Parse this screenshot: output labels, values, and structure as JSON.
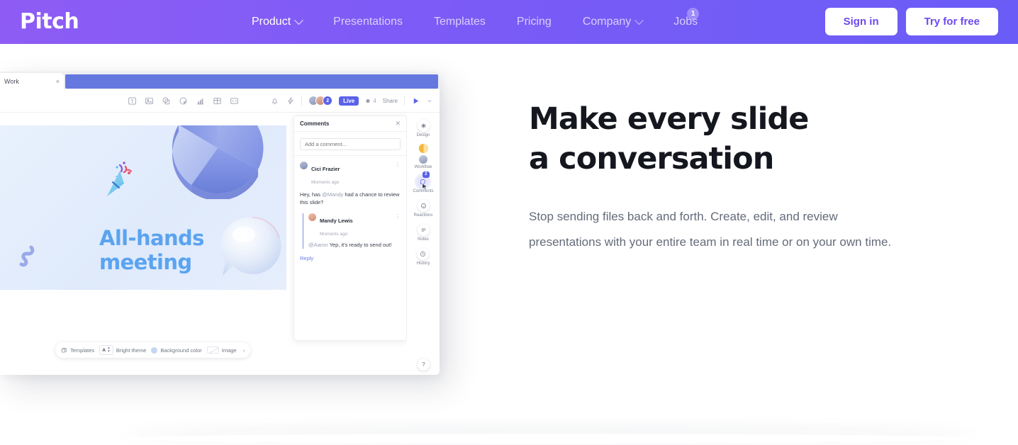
{
  "nav": {
    "brand": "Pitch",
    "links": [
      {
        "label": "Product",
        "has_caret": true,
        "active": true,
        "icon": "chevron-down-icon"
      },
      {
        "label": "Presentations",
        "has_caret": false,
        "active": false
      },
      {
        "label": "Templates",
        "has_caret": false,
        "active": false
      },
      {
        "label": "Pricing",
        "has_caret": false,
        "active": false
      },
      {
        "label": "Company",
        "has_caret": true,
        "active": false,
        "icon": "chevron-down-icon"
      },
      {
        "label": "Jobs",
        "has_caret": false,
        "active": false,
        "badge": "1"
      }
    ],
    "sign_in": "Sign in",
    "try_free": "Try for free",
    "gradient_from": "#8E5CF5",
    "gradient_to": "#6A5CF7",
    "button_text_color": "#6D49F0"
  },
  "hero": {
    "title_line1": "Make every slide",
    "title_line2": "a conversation",
    "subtitle": "Stop sending files back and forth. Create, edit, and review presentations with your entire team in real time or on your own time.",
    "title_color": "#15171F",
    "subtitle_color": "#646B7A"
  },
  "app": {
    "browser": {
      "tab_label": "Work",
      "tab_close": "×",
      "url_bar_color": "#6478E0"
    },
    "toolbar": {
      "insert_tools": [
        {
          "name": "text-tool-icon",
          "title": "Text"
        },
        {
          "name": "image-tool-icon",
          "title": "Image"
        },
        {
          "name": "shape-tool-icon",
          "title": "Shape"
        },
        {
          "name": "sticker-tool-icon",
          "title": "Sticker"
        },
        {
          "name": "chart-tool-icon",
          "title": "Chart"
        },
        {
          "name": "table-tool-icon",
          "title": "Table"
        },
        {
          "name": "embed-tool-icon",
          "title": "Embed"
        }
      ],
      "notification_icon": "bell-icon",
      "activity_icon": "lightning-icon",
      "avatar_count": "2",
      "live_label": "Live",
      "view_count": "4",
      "view_icon": "eye-icon",
      "share_label": "Share",
      "present_icon": "play-icon",
      "present_caret": "chevron-down-icon",
      "accent_color": "#5A62E8"
    },
    "slide": {
      "title_line1": "All-hands",
      "title_line2": "meeting",
      "title_color": "#5BA3F0",
      "background_color": "#E3ECFB",
      "decor": [
        "confetti-popper",
        "pie-chart-3d",
        "speech-bubble-3d",
        "squiggle-3d"
      ]
    },
    "slide_controls": {
      "templates_label": "Templates",
      "templates_icon": "templates-icon",
      "theme_label": "Bright theme",
      "theme_icon": "font-size-icon",
      "background_label": "Background color",
      "background_swatch": "#C5D6F2",
      "image_label": "Image",
      "more_arrow": "›"
    },
    "comments": {
      "title": "Comments",
      "close_icon": "close-icon",
      "input_placeholder": "Add a comment...",
      "threads": [
        {
          "author": "Cici Frazier",
          "time": "Moments ago",
          "text_before": "Hey, has ",
          "mention": "@Mandy",
          "text_after": " had a chance to review this slide?",
          "menu_icon": "kebab-menu-icon",
          "replies": [
            {
              "author": "Mandy Lewis",
              "time": "Moments ago",
              "mention": "@Aaron",
              "text_after": " Yep, it's ready to send out!",
              "menu_icon": "kebab-menu-icon"
            }
          ],
          "reply_label": "Reply"
        }
      ]
    },
    "rail": {
      "items": [
        {
          "label": "Design",
          "icon": "design-sparkle-icon",
          "selected": false
        },
        {
          "label": "Workflow",
          "icon": "workflow-status-icon",
          "selected": false
        },
        {
          "label": "Comments",
          "icon": "comment-bubble-icon",
          "selected": true,
          "badge": "2"
        },
        {
          "label": "Reactions",
          "icon": "smiley-reaction-icon",
          "selected": false
        },
        {
          "label": "Notes",
          "icon": "notes-lines-icon",
          "selected": false
        },
        {
          "label": "History",
          "icon": "history-clock-icon",
          "selected": false
        }
      ],
      "help_label": "?",
      "selected_color": "#5A62E8"
    }
  }
}
